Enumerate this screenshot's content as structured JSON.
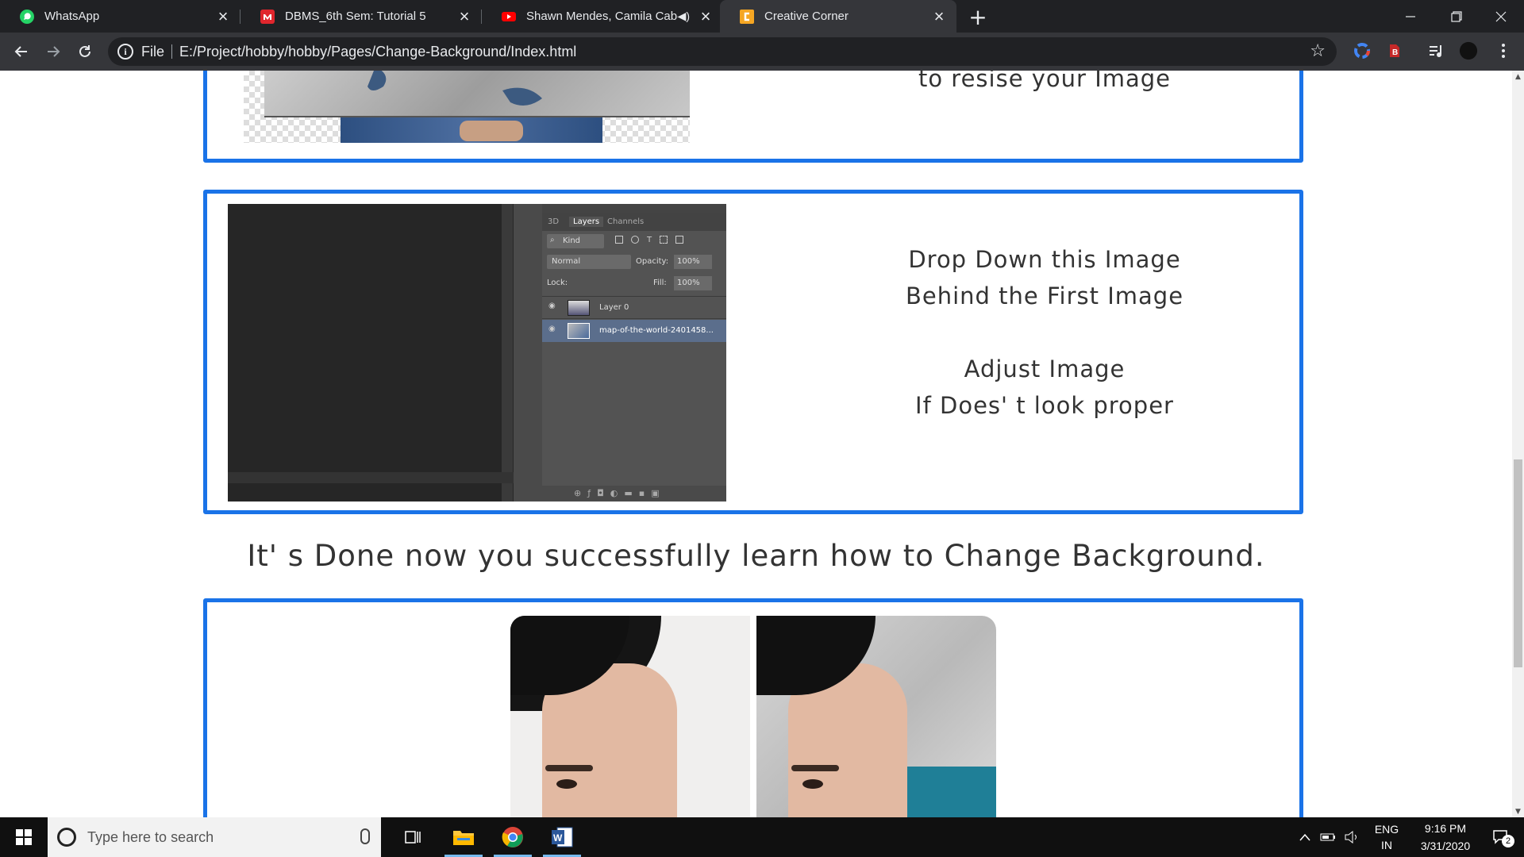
{
  "browser": {
    "tabs": [
      {
        "title": "WhatsApp",
        "icon": "whatsapp-icon",
        "active": false
      },
      {
        "title": "DBMS_6th Sem: Tutorial 5",
        "icon": "mega-icon",
        "active": false
      },
      {
        "title": "Shawn Mendes, Camila Cabe",
        "icon": "youtube-icon",
        "active": false,
        "audio": true
      },
      {
        "title": "Creative Corner",
        "icon": "creative-corner-icon",
        "active": true
      }
    ],
    "new_tab_label": "+",
    "address": {
      "protocol": "File",
      "url": "E:/Project/hobby/hobby/Pages/Change-Background/Index.html"
    }
  },
  "page": {
    "card1_text": "to resise your Image",
    "card2": {
      "line1": "Drop Down this Image",
      "line2": "Behind the First Image",
      "line3": "Adjust Image",
      "line4": "If Does' t look proper"
    },
    "done_text": "It' s Done now you successfully learn how to Change Background.",
    "ps_panel": {
      "tabs": [
        "3D",
        "Layers",
        "Channels"
      ],
      "kind": "Kind",
      "blend_mode": "Normal",
      "opacity_label": "Opacity:",
      "opacity_value": "100%",
      "lock_label": "Lock:",
      "fill_label": "Fill:",
      "fill_value": "100%",
      "layers": [
        "Layer 0",
        "map-of-the-world-2401458..."
      ]
    }
  },
  "taskbar": {
    "search_placeholder": "Type here to search",
    "lang1": "ENG",
    "lang2": "IN",
    "time": "9:16 PM",
    "date": "3/31/2020",
    "notification_count": "2"
  },
  "colors": {
    "accent": "#1a73e8",
    "chrome_dark": "#202124",
    "toolbar": "#35363a"
  }
}
